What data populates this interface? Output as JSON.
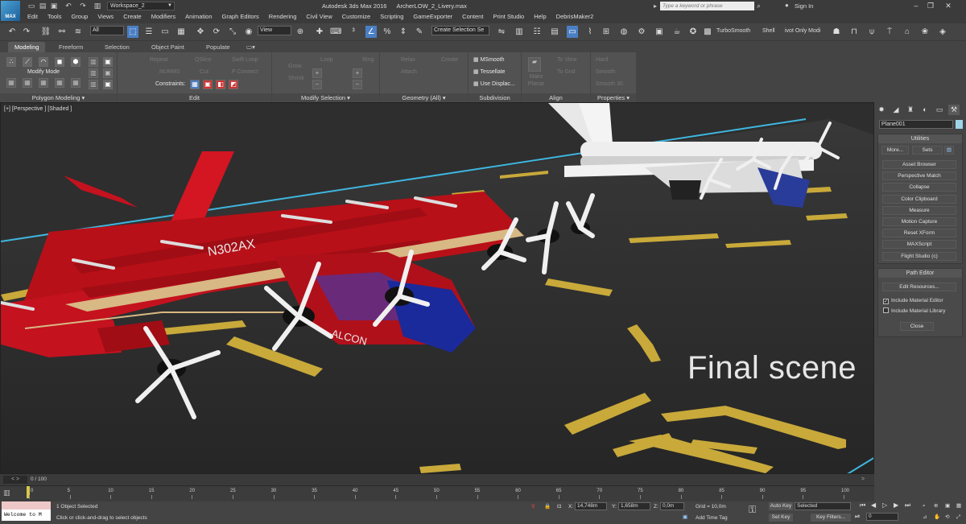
{
  "app": {
    "logo_text": "MAX",
    "workspace": "Workspace_2",
    "product": "Autodesk 3ds Max 2016",
    "file": "ArcherLOW_2_Livery.max",
    "search_placeholder": "Type a keyword or phrase",
    "sign_in": "Sign In"
  },
  "menu": [
    "Edit",
    "Tools",
    "Group",
    "Views",
    "Create",
    "Modifiers",
    "Animation",
    "Graph Editors",
    "Rendering",
    "Civil View",
    "Customize",
    "Scripting",
    "GameExporter",
    "Content",
    "Print Studio",
    "Help",
    "DebrisMaker2"
  ],
  "toolbar": {
    "filter": "All",
    "ref_coord": "View",
    "selection_set": "Create Selection Se",
    "turbosmooth": "TurboSmooth",
    "shell": "Shell",
    "pivot": "ivot Only Modi"
  },
  "ribbon": {
    "tabs": [
      "Modeling",
      "Freeform",
      "Selection",
      "Object Paint",
      "Populate"
    ],
    "active_tab": "Modeling",
    "groups": {
      "polygon_modeling": {
        "title": "Polygon Modeling",
        "modify_mode": "Modify Mode"
      },
      "edit": {
        "title": "Edit",
        "items": [
          "Repeat",
          "QSlice",
          "Swift Loop",
          "NURMS",
          "Cut",
          "P Connect"
        ],
        "constraints": "Constraints:"
      },
      "modify_selection": {
        "title": "Modify Selection",
        "items": [
          "Grow",
          "Shrink",
          "Loop",
          "Ring"
        ]
      },
      "geometry": {
        "title": "Geometry (All)",
        "items": [
          "Relax",
          "Create",
          "Attach"
        ]
      },
      "subdivision": {
        "title": "Subdivision",
        "items": [
          "MSmooth",
          "Tessellate",
          "Use Displac..."
        ]
      },
      "align": {
        "title": "Align",
        "items": [
          "Make Planar",
          "To View",
          "To Grid"
        ]
      },
      "properties": {
        "title": "Properties",
        "items": [
          "Hard",
          "Smooth",
          "Smooth 30"
        ]
      }
    }
  },
  "viewport": {
    "label": "[+] [Perspective ] [Shaded ]",
    "overlay_text": "Final scene",
    "aircraft_registration": "N302AX",
    "aircraft_brand": "ALCON"
  },
  "command_panel": {
    "object_name": "Plane001",
    "object_color": "#9fd5e8",
    "utilities": {
      "title": "Utilities",
      "more": "More...",
      "sets": "Sets",
      "buttons": [
        "Asset Browser",
        "Perspective Match",
        "Collapse",
        "Color Clipboard",
        "Measure",
        "Motion Capture",
        "Reset XForm",
        "MAXScript",
        "Flight Studio (c)"
      ]
    },
    "path_editor": {
      "title": "Path Editor",
      "edit_resources": "Edit Resources...",
      "include_material_editor": "Include Material Editor",
      "include_material_library": "Include Material Library",
      "close": "Close"
    }
  },
  "timeline": {
    "frame": "0 / 100",
    "ticks": [
      "0",
      "5",
      "10",
      "15",
      "20",
      "25",
      "30",
      "35",
      "40",
      "45",
      "50",
      "55",
      "60",
      "65",
      "70",
      "75",
      "80",
      "85",
      "90",
      "95",
      "100"
    ]
  },
  "status": {
    "welcome": "Welcome to M",
    "selection": "1 Object Selected",
    "prompt": "Click or click-and-drag to select objects",
    "x_label": "X:",
    "x": "14,748m",
    "y_label": "Y:",
    "y": "1,658m",
    "z_label": "Z:",
    "z": "0,0m",
    "grid": "Grid = 10,0m",
    "add_time_tag": "Add Time Tag",
    "auto_key": "Auto Key",
    "selected": "Selected",
    "set_key": "Set Key",
    "key_filters": "Key Filters...",
    "frame_field": "0"
  },
  "colors": {
    "accent": "#4b7fc4",
    "ground": "#2f2f2f",
    "marking_yellow": "#c8a93a",
    "boundary_cyan": "#3fb6e0",
    "aircraft_red": "#c4121f",
    "aircraft_blue": "#1a2a9a"
  }
}
